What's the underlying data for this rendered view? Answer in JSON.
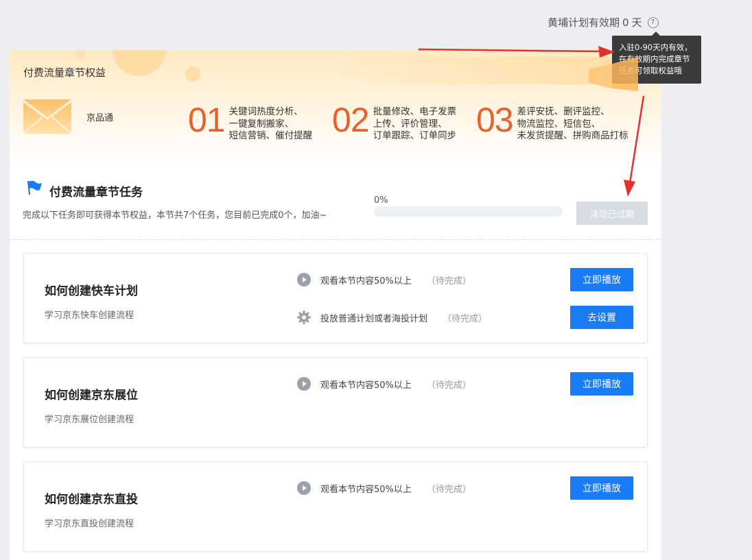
{
  "validity": {
    "label": "黄埔计划有效期",
    "days": "0",
    "unit": "天"
  },
  "tooltip": {
    "line1": "入驻0-90天内有效，",
    "line2": "在有效期内完成章节",
    "line3": "任务可领取权益哦"
  },
  "banner": {
    "title": "付费流量章节权益",
    "product": "京品通",
    "benefits": [
      {
        "num": "01",
        "lines": [
          "关键词热度分析、",
          "一键复制搬家、",
          "短信营销、催付提醒"
        ]
      },
      {
        "num": "02",
        "lines": [
          "批量修改、电子发票",
          "上传、评价管理、",
          "订单跟踪、订单同步"
        ]
      },
      {
        "num": "03",
        "lines": [
          "差评安抚、删评监控、",
          "物流监控、短信包、",
          "未发货提醒、拼购商品打标"
        ]
      }
    ]
  },
  "task": {
    "title": "付费流量章节任务",
    "desc": "完成以下任务即可获得本节权益，本节共7个任务，您目前已完成0个，加油~",
    "progress_label": "0%",
    "progress": 0,
    "expired_btn": "活动已过期"
  },
  "courses": [
    {
      "title": "如何创建快车计划",
      "sub": "学习京东快车创建流程",
      "reqs": [
        {
          "icon": "play-icon",
          "text": "观看本节内容50%以上",
          "status": "（待完成）",
          "btn": "立即播放"
        },
        {
          "icon": "gear-icon",
          "text": "投放普通计划或者海投计划",
          "status": "（待完成）",
          "btn": "去设置"
        }
      ]
    },
    {
      "title": "如何创建京东展位",
      "sub": "学习京东展位创建流程",
      "reqs": [
        {
          "icon": "play-icon",
          "text": "观看本节内容50%以上",
          "status": "（待完成）",
          "btn": "立即播放"
        }
      ]
    },
    {
      "title": "如何创建京东直投",
      "sub": "学习京东直投创建流程",
      "reqs": [
        {
          "icon": "play-icon",
          "text": "观看本节内容50%以上",
          "status": "（待完成）",
          "btn": "立即播放"
        }
      ]
    }
  ],
  "colors": {
    "accent": "#1a7cf2",
    "benefit_number": "#e8612c",
    "annotation_arrow": "#e8302a",
    "expired": "#d7dce3"
  }
}
